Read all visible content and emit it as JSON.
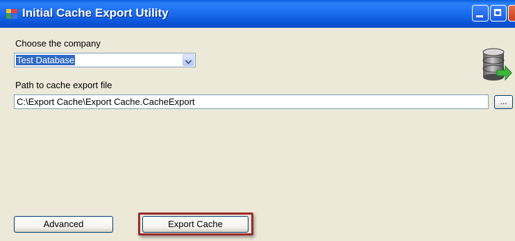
{
  "window": {
    "title": "Initial Cache Export Utility",
    "app_icon": "app-icon",
    "controls": [
      "minimize-icon",
      "maximize-icon",
      "close-icon"
    ]
  },
  "company": {
    "label": "Choose the company",
    "selected": "Test Database"
  },
  "path": {
    "label": "Path to cache export file",
    "value": "C:\\Export Cache\\Export Cache.CacheExport",
    "browse_label": "..."
  },
  "buttons": {
    "advanced": "Advanced",
    "export": "Export Cache"
  },
  "icons": {
    "database": "database-export-icon"
  },
  "colors": {
    "title_bar": "#0A5FE0",
    "window_bg": "#ECE9D8",
    "selection": "#316AC5",
    "highlight_border": "#9A2A2A"
  }
}
